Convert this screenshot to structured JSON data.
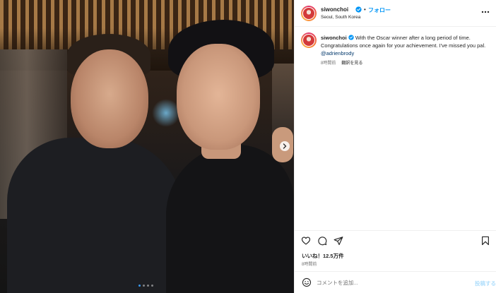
{
  "post": {
    "username": "siwonchoi",
    "separator": "•",
    "follow_label": "フォロー",
    "location": "Seoul, South Korea",
    "caption_text": " With the Oscar winner after a long period of time. Congratulations once again for your achievement. I've missed you pal. ",
    "caption_mention": "@adrienbrody",
    "caption_time": "8時間前",
    "translate_label": "翻訳を見る",
    "likes_label": "いいね！12.5万件",
    "post_time": "8時間前",
    "comment_placeholder": "コメントを追加...",
    "post_button_label": "投稿する"
  },
  "carousel": {
    "total": 4,
    "active_index": 0
  },
  "colors": {
    "accent": "#0095f6",
    "verified": "#0095f6",
    "muted_text": "#737373",
    "divider": "#efefef"
  },
  "icons": {
    "header_more": "more-dots-icon",
    "verified": "verified-badge-icon",
    "like": "heart-icon",
    "comment": "comment-bubble-icon",
    "share": "paper-plane-icon",
    "save": "bookmark-icon",
    "emoji": "smiley-icon",
    "next": "chevron-right-icon"
  }
}
